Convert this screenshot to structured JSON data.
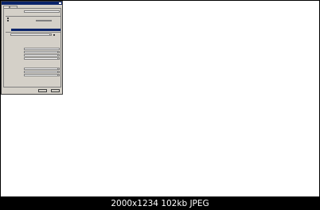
{
  "image_caption": "2000x1234 102kb JPEG"
}
